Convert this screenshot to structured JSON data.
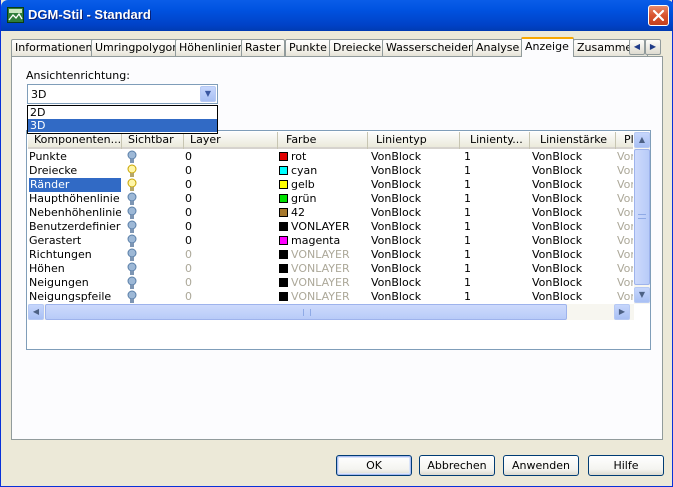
{
  "window": {
    "title": "DGM-Stil - Standard"
  },
  "tabs": [
    {
      "label": "Informationen"
    },
    {
      "label": "Umringpolygon"
    },
    {
      "label": "Höhenlinien"
    },
    {
      "label": "Raster"
    },
    {
      "label": "Punkte"
    },
    {
      "label": "Dreiecke"
    },
    {
      "label": "Wasserscheiden"
    },
    {
      "label": "Analyse"
    },
    {
      "label": "Anzeige"
    },
    {
      "label": "Zusammenf"
    }
  ],
  "active_tab": "Anzeige",
  "view_direction": {
    "label": "Ansichtenrichtung:",
    "value": "3D",
    "options": [
      "2D",
      "3D"
    ]
  },
  "grid": {
    "columns": [
      "Komponenten...",
      "Sichtbar",
      "Layer",
      "Farbe",
      "Linientyp",
      "Linienty...",
      "Linienstärke",
      "Pl"
    ],
    "rows": [
      {
        "name": "Punkte",
        "visible": true,
        "layer": "0",
        "color": "rot",
        "swatch": "#e00000",
        "linetype": "VonBlock",
        "scale": "1",
        "weight": "VonBlock",
        "plot": "Vor"
      },
      {
        "name": "Dreiecke",
        "visible": false,
        "layer": "0",
        "color": "cyan",
        "swatch": "#00ffff",
        "linetype": "VonBlock",
        "scale": "1",
        "weight": "VonBlock",
        "plot": "Vor"
      },
      {
        "name": "Ränder",
        "visible": false,
        "layer": "0",
        "color": "gelb",
        "swatch": "#ffff00",
        "linetype": "VonBlock",
        "scale": "1",
        "weight": "VonBlock",
        "plot": "Vor"
      },
      {
        "name": "Haupthöhenlinie",
        "visible": true,
        "layer": "0",
        "color": "grün",
        "swatch": "#00e000",
        "linetype": "VonBlock",
        "scale": "1",
        "weight": "VonBlock",
        "plot": "Vor"
      },
      {
        "name": "Nebenhöhenlinie",
        "visible": true,
        "layer": "0",
        "color": "42",
        "swatch": "#a6782c",
        "linetype": "VonBlock",
        "scale": "1",
        "weight": "VonBlock",
        "plot": "Vor"
      },
      {
        "name": "Benutzerdefinierte",
        "visible": true,
        "layer": "0",
        "color": "VONLAYER",
        "swatch": "#000000",
        "linetype": "VonBlock",
        "scale": "1",
        "weight": "VonBlock",
        "plot": "Vor"
      },
      {
        "name": "Gerastert",
        "visible": true,
        "layer": "0",
        "color": "magenta",
        "swatch": "#ff00ff",
        "linetype": "VonBlock",
        "scale": "1",
        "weight": "VonBlock",
        "plot": "Vor"
      },
      {
        "name": "Richtungen",
        "visible": true,
        "disabled": true,
        "layer": "0",
        "color": "VONLAYER",
        "swatch": "#000000",
        "linetype": "VonBlock",
        "scale": "1",
        "weight": "VonBlock",
        "plot": "Vor"
      },
      {
        "name": "Höhen",
        "visible": true,
        "disabled": true,
        "layer": "0",
        "color": "VONLAYER",
        "swatch": "#000000",
        "linetype": "VonBlock",
        "scale": "1",
        "weight": "VonBlock",
        "plot": "Vor"
      },
      {
        "name": "Neigungen",
        "visible": true,
        "disabled": true,
        "layer": "0",
        "color": "VONLAYER",
        "swatch": "#000000",
        "linetype": "VonBlock",
        "scale": "1",
        "weight": "VonBlock",
        "plot": "Vor"
      },
      {
        "name": "Neigungspfeile",
        "visible": true,
        "disabled": true,
        "layer": "0",
        "color": "VONLAYER",
        "swatch": "#000000",
        "linetype": "VonBlock",
        "scale": "1",
        "weight": "VonBlock",
        "plot": "Vor"
      }
    ],
    "selected_row": "Ränder"
  },
  "buttons": {
    "ok": "OK",
    "cancel": "Abbrechen",
    "apply": "Anwenden",
    "help": "Hilfe"
  },
  "icons": {
    "app": "dgm-style-icon",
    "close": "close-icon",
    "bulb_on": "lightbulb-on-icon",
    "bulb_off": "lightbulb-off-icon"
  }
}
